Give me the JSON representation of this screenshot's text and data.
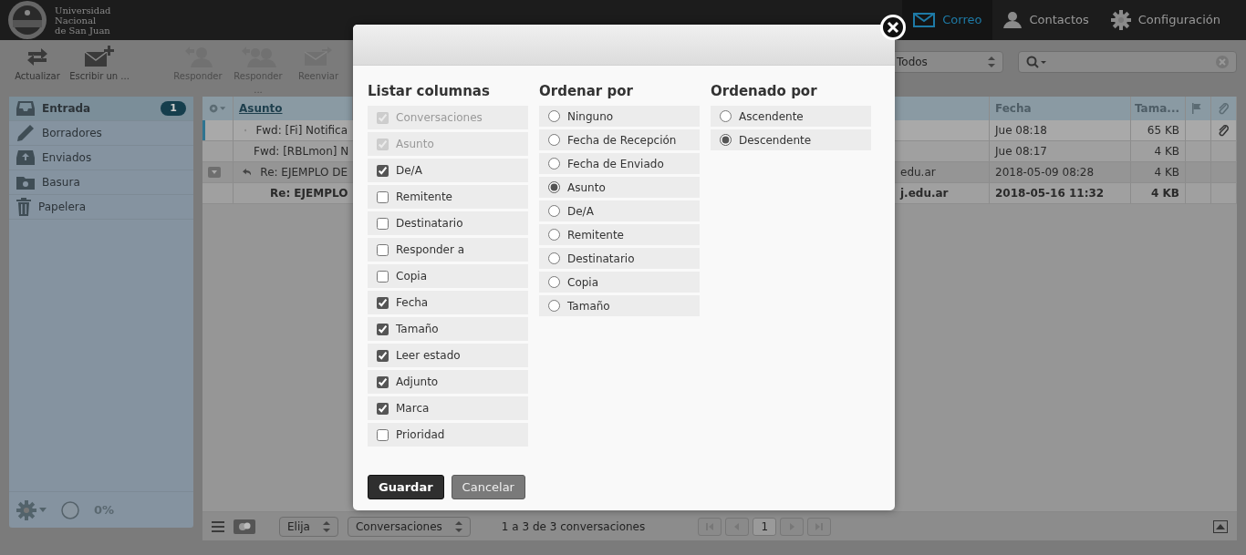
{
  "header": {
    "logo_lines": [
      "Universidad",
      "Nacional",
      "de San Juan"
    ],
    "nav": [
      {
        "label": "Correo",
        "selected": true
      },
      {
        "label": "Contactos",
        "selected": false
      },
      {
        "label": "Configuración",
        "selected": false
      }
    ]
  },
  "toolbar": {
    "buttons": [
      {
        "label": "Actualizar",
        "disabled": false
      },
      {
        "label": "Escribir un ...",
        "disabled": false
      },
      {
        "label": "Responder",
        "disabled": true
      },
      {
        "label": "Responder ...",
        "disabled": true
      },
      {
        "label": "Reenviar",
        "disabled": true
      }
    ],
    "filter": {
      "value": "Todos"
    }
  },
  "sidebar": {
    "folders": [
      {
        "name": "Entrada",
        "selected": true,
        "count": "1"
      },
      {
        "name": "Borradores",
        "selected": false
      },
      {
        "name": "Enviados",
        "selected": false
      },
      {
        "name": "Basura",
        "selected": false
      },
      {
        "name": "Papelera",
        "selected": false
      }
    ],
    "quota": "0%"
  },
  "message_list": {
    "columns": [
      {
        "label": "Asunto",
        "sorted": true
      },
      {
        "label": "Fecha",
        "sorted": false
      },
      {
        "label": "Tama...",
        "sorted": false
      }
    ],
    "rows": [
      {
        "kind": "message",
        "subject": "Fwd: [Fi] Notifica",
        "from": "",
        "date": "Jue 08:18",
        "size": "65 KB",
        "unread": false,
        "attachment": true,
        "focused": true
      },
      {
        "kind": "message",
        "subject": "Fwd: [RBLmon] N",
        "from": "",
        "date": "Jue 08:17",
        "size": "4 KB",
        "unread": false,
        "attachment": false,
        "focused": false
      },
      {
        "kind": "thread",
        "subject": "Re: EJEMPLO DE",
        "from": "edu.ar",
        "date": "2018-05-09 08:28",
        "size": "4 KB",
        "unread": false,
        "attachment": false,
        "focused": false
      },
      {
        "kind": "child",
        "subject": "Re: EJEMPLO",
        "from": "j.edu.ar",
        "date": "2018-05-16 11:32",
        "size": "4 KB",
        "unread": true,
        "attachment": false,
        "focused": false
      }
    ],
    "footer": {
      "select_mode": "Elija",
      "threading": "Conversaciones",
      "count": "1 a 3 de 3 conversaciones",
      "page": "1"
    }
  },
  "dialog": {
    "sections": [
      {
        "kind": "checkbox",
        "title": "Listar columnas",
        "options": [
          {
            "label": "Conversaciones",
            "checked": true,
            "disabled": true
          },
          {
            "label": "Asunto",
            "checked": true,
            "disabled": true
          },
          {
            "label": "De/A",
            "checked": true,
            "disabled": false
          },
          {
            "label": "Remitente",
            "checked": false,
            "disabled": false
          },
          {
            "label": "Destinatario",
            "checked": false,
            "disabled": false
          },
          {
            "label": "Responder a",
            "checked": false,
            "disabled": false
          },
          {
            "label": "Copia",
            "checked": false,
            "disabled": false
          },
          {
            "label": "Fecha",
            "checked": true,
            "disabled": false
          },
          {
            "label": "Tamaño",
            "checked": true,
            "disabled": false
          },
          {
            "label": "Leer estado",
            "checked": true,
            "disabled": false
          },
          {
            "label": "Adjunto",
            "checked": true,
            "disabled": false
          },
          {
            "label": "Marca",
            "checked": true,
            "disabled": false
          },
          {
            "label": "Prioridad",
            "checked": false,
            "disabled": false
          }
        ]
      },
      {
        "kind": "radio",
        "title": "Ordenar por",
        "options": [
          {
            "label": "Ninguno",
            "selected": false
          },
          {
            "label": "Fecha de Recepción",
            "selected": false
          },
          {
            "label": "Fecha de Enviado",
            "selected": false
          },
          {
            "label": "Asunto",
            "selected": true
          },
          {
            "label": "De/A",
            "selected": false
          },
          {
            "label": "Remitente",
            "selected": false
          },
          {
            "label": "Destinatario",
            "selected": false
          },
          {
            "label": "Copia",
            "selected": false
          },
          {
            "label": "Tamaño",
            "selected": false
          }
        ]
      },
      {
        "kind": "radio",
        "title": "Ordenado por",
        "options": [
          {
            "label": "Ascendente",
            "selected": false
          },
          {
            "label": "Descendente",
            "selected": true
          }
        ]
      }
    ],
    "buttons": [
      {
        "label": "Guardar",
        "kind": "primary"
      },
      {
        "label": "Cancelar",
        "kind": "secondary"
      }
    ]
  }
}
